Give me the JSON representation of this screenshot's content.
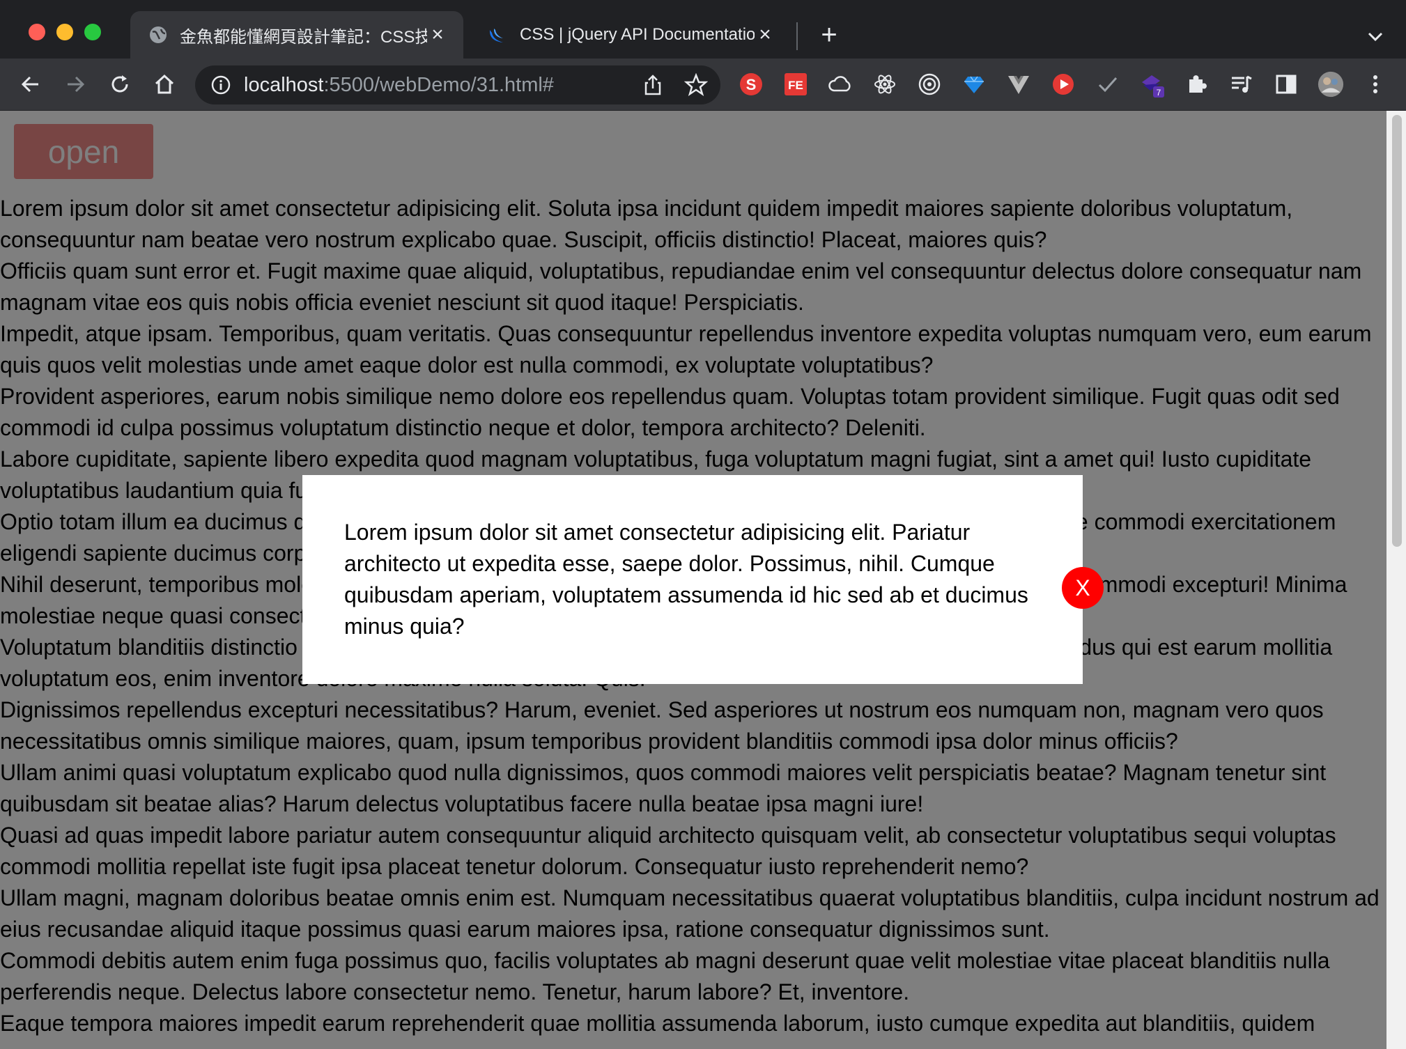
{
  "browser": {
    "tabs": [
      {
        "title": "金魚都能懂網頁設計筆記：CSS技",
        "active": true,
        "favicon": "globe-icon"
      },
      {
        "title": "CSS | jQuery API Documentatio",
        "active": false,
        "favicon": "jquery-icon"
      }
    ],
    "address": {
      "host": "localhost",
      "path": ":5500/webDemo/31.html#"
    },
    "extension_badge": "7",
    "extension_s": "S",
    "extension_fe": "FE"
  },
  "page": {
    "open_button_label": "open",
    "paragraphs": [
      "Lorem ipsum dolor sit amet consectetur adipisicing elit. Soluta ipsa incidunt quidem impedit maiores sapiente doloribus voluptatum, consequuntur nam beatae vero nostrum explicabo quae. Suscipit, officiis distinctio! Placeat, maiores quis?",
      "Officiis quam sunt error et. Fugit maxime quae aliquid, voluptatibus, repudiandae enim vel consequuntur delectus dolore consequatur nam magnam vitae eos quis nobis officia eveniet nesciunt sit quod itaque! Perspiciatis.",
      "Impedit, atque ipsam. Temporibus, quam veritatis. Quas consequuntur repellendus inventore expedita voluptas numquam vero, eum earum quis quos velit molestias unde amet eaque dolor est nulla commodi, ex voluptate voluptatibus?",
      "Provident asperiores, earum nobis similique nemo dolore eos repellendus quam. Voluptas totam provident similique. Fugit quas odit sed commodi id culpa possimus voluptatum distinctio neque et dolor, tempora architecto? Deleniti.",
      "Labore cupiditate, sapiente libero expedita quod magnam voluptatibus, fuga voluptatum magni fugiat, sint a amet qui! Iusto cupiditate voluptatibus laudantium quia fugit dolorem quibusdam aspernatur, soluta illo.",
      "Optio totam illum ea ducimus quibusdam reiciendis, iusto corporis quia voluptatibus minima, quibusdam saepe commodi exercitationem eligendi sapiente ducimus corporis voluptatum vero facere eligendi.",
      "Nihil deserunt, temporibus molestias doloremque vero ut libero saepe nam quod praesentium enim sint modi commodi excepturi! Minima molestiae neque quasi consectetur ut ea perferendis neque?",
      "Voluptatum blanditiis distinctio iusto recusandae placeat consectetur quis modi nam quam, cupiditate repellendus qui est earum mollitia voluptatum eos, enim inventore dolore maxime nulla soluta. Quis.",
      "Dignissimos repellendus excepturi necessitatibus? Harum, eveniet. Sed asperiores ut nostrum eos numquam non, magnam vero quos necessitatibus omnis similique maiores, quam, ipsum temporibus provident blanditiis commodi ipsa dolor minus officiis?",
      "Ullam animi quasi voluptatum explicabo quod nulla dignissimos, quos commodi maiores velit perspiciatis beatae? Magnam tenetur sint quibusdam sit beatae alias? Harum delectus voluptatibus facere nulla beatae ipsa magni iure!",
      "Quasi ad quas impedit labore pariatur autem consequuntur aliquid architecto quisquam velit, ab consectetur voluptatibus sequi voluptas commodi mollitia repellat iste fugit ipsa placeat tenetur dolorum. Consequatur iusto reprehenderit nemo?",
      "Ullam magni, magnam doloribus beatae omnis enim est. Numquam necessitatibus quaerat voluptatibus blanditiis, culpa incidunt nostrum ad eius recusandae aliquid itaque possimus quasi earum maiores ipsa, ratione consequatur dignissimos sunt.",
      "Commodi debitis autem enim fuga possimus quo, facilis voluptates ab magni deserunt quae velit molestiae vitae placeat blanditiis nulla perferendis neque. Delectus labore consectetur nemo. Tenetur, harum labore? Et, inventore.",
      "Eaque tempora maiores impedit earum reprehenderit quae mollitia assumenda laborum, iusto cumque expedita aut blanditiis, quidem"
    ]
  },
  "modal": {
    "text": "Lorem ipsum dolor sit amet consectetur adipisicing elit. Pariatur architecto ut expedita esse, saepe dolor. Possimus, nihil. Cumque quibusdam aperiam, voluptatem assumenda id hic sed ab et ducimus minus quia?",
    "close_label": "X"
  },
  "colors": {
    "accent_red": "#ff0000",
    "open_button": "#f08a88",
    "overlay": "rgba(0,0,0,0.5)"
  }
}
